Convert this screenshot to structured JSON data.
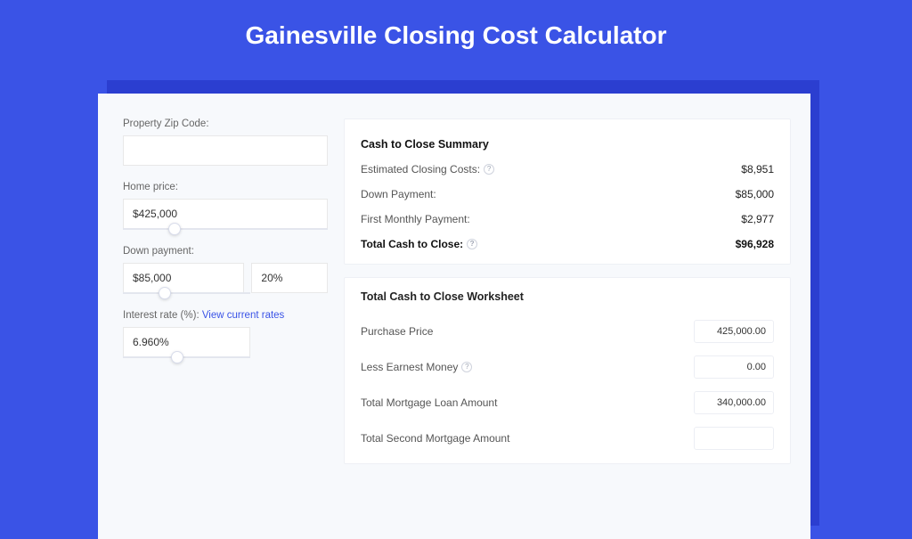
{
  "title": "Gainesville Closing Cost Calculator",
  "form": {
    "zip": {
      "label": "Property Zip Code:",
      "value": ""
    },
    "homePrice": {
      "label": "Home price:",
      "value": "$425,000",
      "sliderPos": 22
    },
    "downPayment": {
      "label": "Down payment:",
      "amount": "$85,000",
      "pct": "20%",
      "sliderPos": 28
    },
    "rate": {
      "label": "Interest rate (%): ",
      "link": "View current rates",
      "value": "6.960%",
      "sliderPos": 38
    }
  },
  "summary": {
    "title": "Cash to Close Summary",
    "lines": [
      {
        "label": "Estimated Closing Costs:",
        "help": true,
        "value": "$8,951"
      },
      {
        "label": "Down Payment:",
        "help": false,
        "value": "$85,000"
      },
      {
        "label": "First Monthly Payment:",
        "help": false,
        "value": "$2,977"
      }
    ],
    "total": {
      "label": "Total Cash to Close:",
      "help": true,
      "value": "$96,928"
    }
  },
  "worksheet": {
    "title": "Total Cash to Close Worksheet",
    "rows": [
      {
        "label": "Purchase Price",
        "help": false,
        "value": "425,000.00"
      },
      {
        "label": "Less Earnest Money",
        "help": true,
        "value": "0.00"
      },
      {
        "label": "Total Mortgage Loan Amount",
        "help": false,
        "value": "340,000.00"
      },
      {
        "label": "Total Second Mortgage Amount",
        "help": false,
        "value": ""
      }
    ]
  }
}
